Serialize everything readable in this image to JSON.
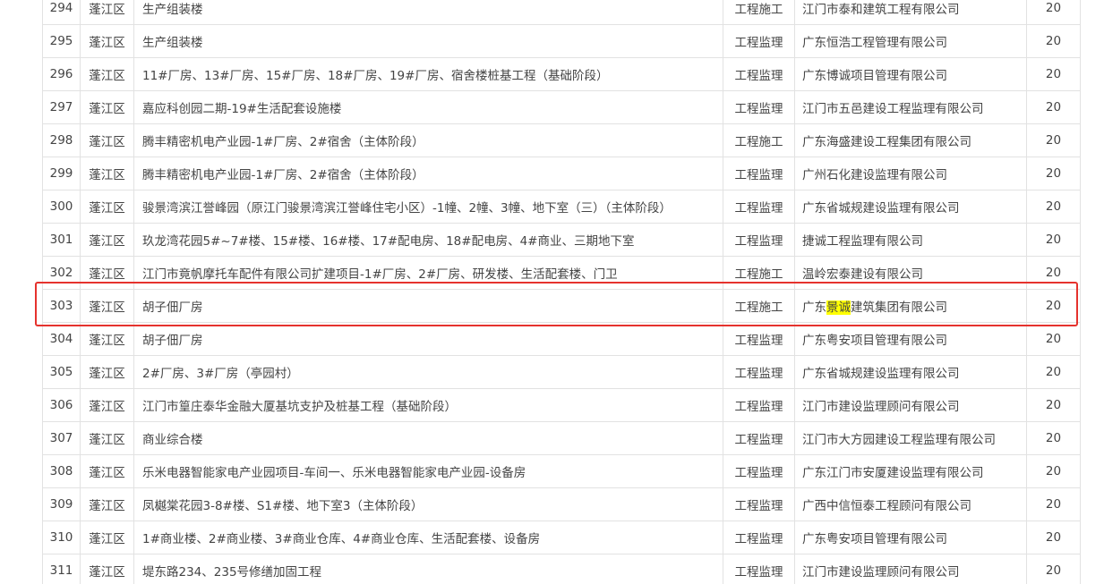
{
  "table": {
    "rows": [
      {
        "num": "294",
        "district": "蓬江区",
        "project": "生产组装楼",
        "type": "工程施工",
        "company": "江门市泰和建筑工程有限公司",
        "company_pre": "江门市泰和建筑工程有限公司",
        "company_hl": "",
        "company_post": "",
        "score": "20"
      },
      {
        "num": "295",
        "district": "蓬江区",
        "project": "生产组装楼",
        "type": "工程监理",
        "company": "广东恒浩工程管理有限公司",
        "company_pre": "广东恒浩工程管理有限公司",
        "company_hl": "",
        "company_post": "",
        "score": "20"
      },
      {
        "num": "296",
        "district": "蓬江区",
        "project": "11#厂房、13#厂房、15#厂房、18#厂房、19#厂房、宿舍楼桩基工程（基础阶段）",
        "type": "工程监理",
        "company": "广东博诚项目管理有限公司",
        "company_pre": "广东博诚项目管理有限公司",
        "company_hl": "",
        "company_post": "",
        "score": "20"
      },
      {
        "num": "297",
        "district": "蓬江区",
        "project": "嘉应科创园二期-19#生活配套设施楼",
        "type": "工程监理",
        "company": "江门市五邑建设工程监理有限公司",
        "company_pre": "江门市五邑建设工程监理有限公司",
        "company_hl": "",
        "company_post": "",
        "score": "20"
      },
      {
        "num": "298",
        "district": "蓬江区",
        "project": "腾丰精密机电产业园-1#厂房、2#宿舍（主体阶段）",
        "type": "工程施工",
        "company": "广东海盛建设工程集团有限公司",
        "company_pre": "广东海盛建设工程集团有限公司",
        "company_hl": "",
        "company_post": "",
        "score": "20"
      },
      {
        "num": "299",
        "district": "蓬江区",
        "project": "腾丰精密机电产业园-1#厂房、2#宿舍（主体阶段）",
        "type": "工程监理",
        "company": "广州石化建设监理有限公司",
        "company_pre": "广州石化建设监理有限公司",
        "company_hl": "",
        "company_post": "",
        "score": "20"
      },
      {
        "num": "300",
        "district": "蓬江区",
        "project": "骏景湾滨江誉峰园（原江门骏景湾滨江誉峰住宅小区）-1幢、2幢、3幢、地下室（三）（主体阶段）",
        "type": "工程监理",
        "company": "广东省城规建设监理有限公司",
        "company_pre": "广东省城规建设监理有限公司",
        "company_hl": "",
        "company_post": "",
        "score": "20"
      },
      {
        "num": "301",
        "district": "蓬江区",
        "project": "玖龙湾花园5#~7#楼、15#楼、16#楼、17#配电房、18#配电房、4#商业、三期地下室",
        "type": "工程监理",
        "company": "捷诚工程监理有限公司",
        "company_pre": "捷诚工程监理有限公司",
        "company_hl": "",
        "company_post": "",
        "score": "20"
      },
      {
        "num": "302",
        "district": "蓬江区",
        "project": "江门市竟帆摩托车配件有限公司扩建项目-1#厂房、2#厂房、研发楼、生活配套楼、门卫",
        "type": "工程施工",
        "company": "温岭宏泰建设有限公司",
        "company_pre": "温岭宏泰建设有限公司",
        "company_hl": "",
        "company_post": "",
        "score": "20"
      },
      {
        "num": "303",
        "district": "蓬江区",
        "project": "胡子佃厂房",
        "type": "工程施工",
        "company": "广东景诚建筑集团有限公司",
        "company_pre": "广东",
        "company_hl": "景诚",
        "company_post": "建筑集团有限公司",
        "score": "20"
      },
      {
        "num": "304",
        "district": "蓬江区",
        "project": "胡子佃厂房",
        "type": "工程监理",
        "company": "广东粤安项目管理有限公司",
        "company_pre": "广东粤安项目管理有限公司",
        "company_hl": "",
        "company_post": "",
        "score": "20"
      },
      {
        "num": "305",
        "district": "蓬江区",
        "project": "2#厂房、3#厂房（亭园村）",
        "type": "工程监理",
        "company": "广东省城规建设监理有限公司",
        "company_pre": "广东省城规建设监理有限公司",
        "company_hl": "",
        "company_post": "",
        "score": "20"
      },
      {
        "num": "306",
        "district": "蓬江区",
        "project": "江门市篁庄泰华金融大厦基坑支护及桩基工程（基础阶段）",
        "type": "工程监理",
        "company": "江门市建设监理顾问有限公司",
        "company_pre": "江门市建设监理顾问有限公司",
        "company_hl": "",
        "company_post": "",
        "score": "20"
      },
      {
        "num": "307",
        "district": "蓬江区",
        "project": "商业综合楼",
        "type": "工程监理",
        "company": "江门市大方园建设工程监理有限公司",
        "company_pre": "江门市大方园建设工程监理有限公司",
        "company_hl": "",
        "company_post": "",
        "score": "20"
      },
      {
        "num": "308",
        "district": "蓬江区",
        "project": "乐米电器智能家电产业园项目-车间一、乐米电器智能家电产业园-设备房",
        "type": "工程监理",
        "company": "广东江门市安厦建设监理有限公司",
        "company_pre": "广东江门市安厦建设监理有限公司",
        "company_hl": "",
        "company_post": "",
        "score": "20"
      },
      {
        "num": "309",
        "district": "蓬江区",
        "project": "凤樾棠花园3-8#楼、S1#楼、地下室3（主体阶段）",
        "type": "工程监理",
        "company": "广西中信恒泰工程顾问有限公司",
        "company_pre": "广西中信恒泰工程顾问有限公司",
        "company_hl": "",
        "company_post": "",
        "score": "20"
      },
      {
        "num": "310",
        "district": "蓬江区",
        "project": "1#商业楼、2#商业楼、3#商业仓库、4#商业仓库、生活配套楼、设备房",
        "type": "工程监理",
        "company": "广东粤安项目管理有限公司",
        "company_pre": "广东粤安项目管理有限公司",
        "company_hl": "",
        "company_post": "",
        "score": "20"
      },
      {
        "num": "311",
        "district": "蓬江区",
        "project": "堤东路234、235号修缮加固工程",
        "type": "工程监理",
        "company": "江门市建设监理顾问有限公司",
        "company_pre": "江门市建设监理顾问有限公司",
        "company_hl": "",
        "company_post": "",
        "score": "20"
      }
    ]
  },
  "colors": {
    "highlight": "#ffff00",
    "selection_box": "#e5322d",
    "border": "#e2e2e2",
    "text": "#444444"
  }
}
